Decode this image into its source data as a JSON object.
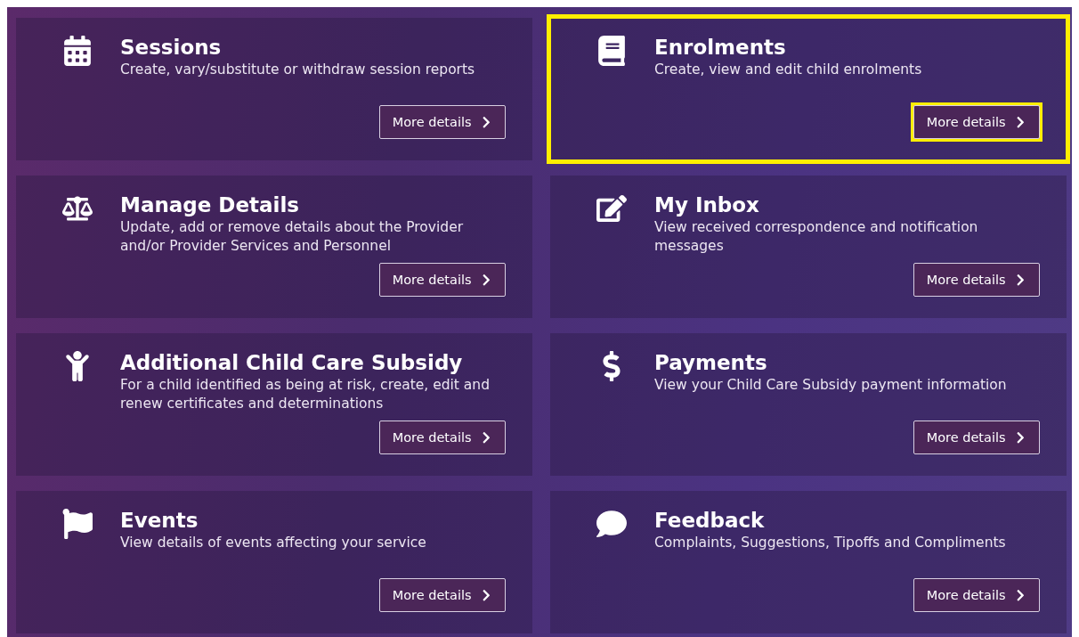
{
  "tiles": [
    {
      "title": "Sessions",
      "description": "Create, vary/substitute or withdraw session reports",
      "button": "More details",
      "highlighted": false,
      "button_highlighted": false
    },
    {
      "title": "Enrolments",
      "description": "Create, view and edit child enrolments",
      "button": "More details",
      "highlighted": true,
      "button_highlighted": true
    },
    {
      "title": "Manage Details",
      "description": "Update, add or remove details about the Provider and/or Provider Services and Personnel",
      "button": "More details",
      "highlighted": false,
      "button_highlighted": false
    },
    {
      "title": "My Inbox",
      "description": "View received correspondence and notification messages",
      "button": "More details",
      "highlighted": false,
      "button_highlighted": false
    },
    {
      "title": "Additional Child Care Subsidy",
      "description": "For a child identified as being at risk, create, edit and renew certificates and determinations",
      "button": "More details",
      "highlighted": false,
      "button_highlighted": false
    },
    {
      "title": "Payments",
      "description": "View your Child Care Subsidy payment information",
      "button": "More details",
      "highlighted": false,
      "button_highlighted": false
    },
    {
      "title": "Events",
      "description": "View details of events affecting your service",
      "button": "More details",
      "highlighted": false,
      "button_highlighted": false
    },
    {
      "title": "Feedback",
      "description": "Complaints, Suggestions, Tipoffs and Compliments",
      "button": "More details",
      "highlighted": false,
      "button_highlighted": false
    }
  ]
}
